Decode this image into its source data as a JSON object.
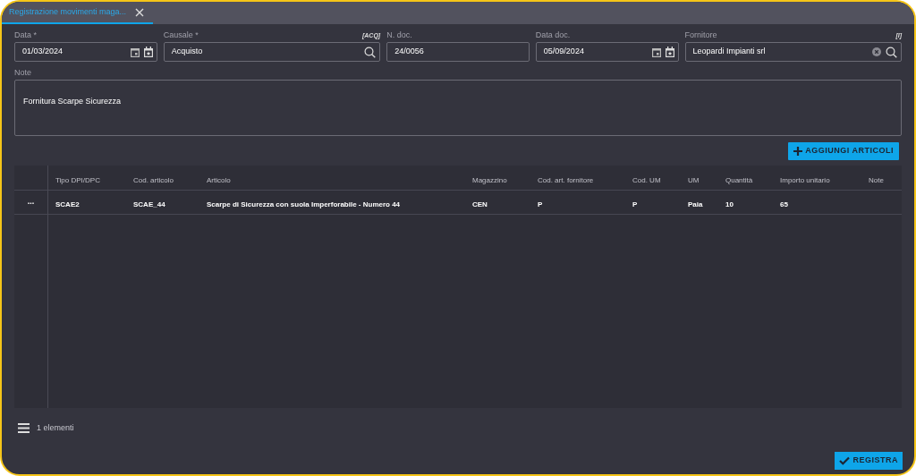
{
  "tabs": [
    {
      "label": "Registrazione movimenti maga...",
      "selected": true
    }
  ],
  "fields": [
    {
      "kind": "date",
      "label": "Data *",
      "value": "01/03/2024"
    },
    {
      "kind": "lookup",
      "label": "Causale *",
      "tag": "[ACQ]",
      "value": "Acquisto"
    },
    {
      "kind": "text",
      "label": "N. doc.",
      "value": "24/0056"
    },
    {
      "kind": "date",
      "label": "Data doc.",
      "value": "05/09/2024"
    },
    {
      "kind": "lookup",
      "label": "Fornitore",
      "tag": "[I]",
      "value": "Leopardi Impianti srl",
      "clearable": true
    }
  ],
  "note": {
    "label": "Note",
    "value": "Fornitura Scarpe Sicurezza"
  },
  "add_button": "AGGIUNGI ARTICOLI",
  "table": {
    "columns": [
      "Tipo DPI/DPC",
      "Cod. articolo",
      "Articolo",
      "Magazzino",
      "Cod. art. fornitore",
      "Cod. UM",
      "UM",
      "Quantità",
      "Importo unitario",
      "Note"
    ],
    "rows": [
      {
        "menu": "...",
        "cells": [
          "SCAE2",
          "SCAE_44",
          "Scarpe di Sicurezza con suola Imperforabile - Numero 44",
          "CEN",
          "P",
          "P",
          "Paia",
          "10",
          "65",
          ""
        ]
      }
    ]
  },
  "footer": {
    "count": "1 elementi"
  },
  "submit_button": "REGISTRA"
}
